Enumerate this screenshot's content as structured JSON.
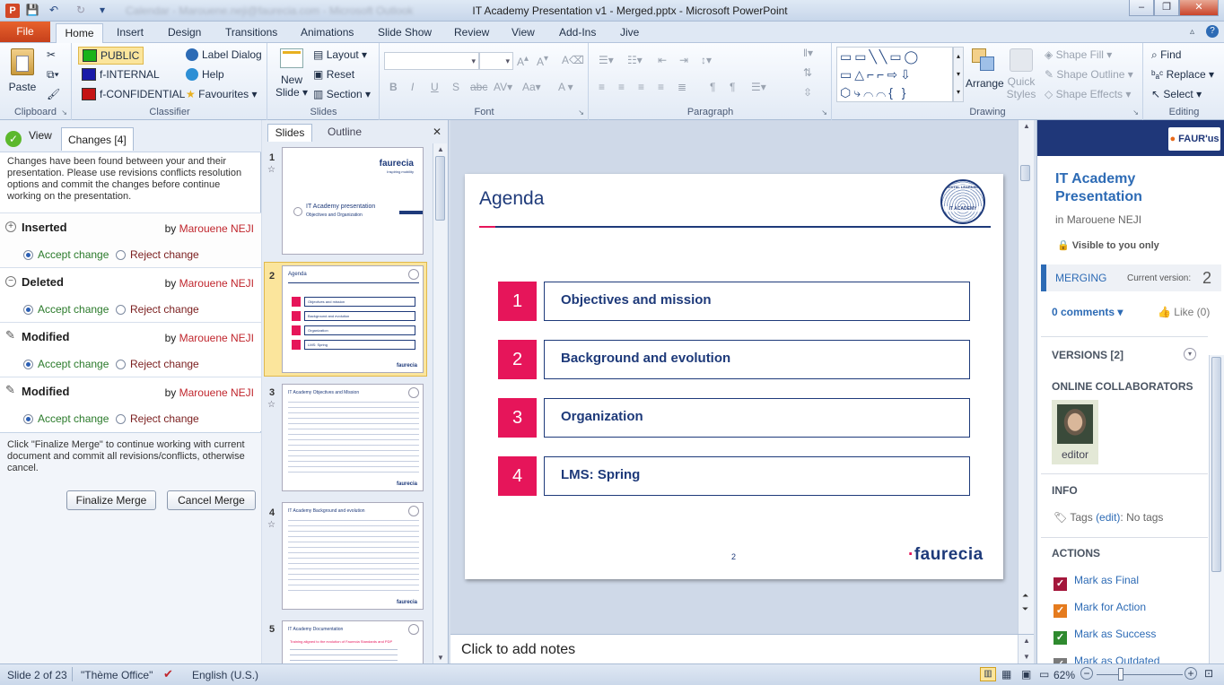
{
  "window": {
    "title": "IT Academy Presentation v1 - Merged.pptx - Microsoft PowerPoint",
    "blurred_title": "Calendar - Marouene.neji@faurecia.com - Microsoft Outlook"
  },
  "tabs": [
    "File",
    "Home",
    "Insert",
    "Design",
    "Transitions",
    "Animations",
    "Slide Show",
    "Review",
    "View",
    "Add-Ins",
    "Jive"
  ],
  "ribbon": {
    "clipboard": {
      "label": "Clipboard",
      "paste": "Paste"
    },
    "classifier": {
      "label": "Classifier",
      "items": [
        {
          "label": "PUBLIC",
          "color": "#19b219"
        },
        {
          "label": "f-INTERNAL",
          "color": "#1a1aa8"
        },
        {
          "label": "f-CONFIDENTIAL",
          "color": "#c41414"
        }
      ],
      "label_dialog": "Label Dialog",
      "help": "Help",
      "favourites": "Favourites"
    },
    "slides": {
      "label": "Slides",
      "new_slide": "New",
      "new_slide2": "Slide",
      "layout": "Layout",
      "reset": "Reset",
      "section": "Section"
    },
    "font": {
      "label": "Font"
    },
    "paragraph": {
      "label": "Paragraph"
    },
    "drawing": {
      "label": "Drawing",
      "arrange": "Arrange",
      "quick": "Quick",
      "styles": "Styles",
      "shape_fill": "Shape Fill",
      "shape_outline": "Shape Outline",
      "shape_effects": "Shape Effects"
    },
    "editing": {
      "label": "Editing",
      "find": "Find",
      "replace": "Replace",
      "select": "Select"
    }
  },
  "review_panel": {
    "view_tab": "View",
    "changes_tab": "Changes [4]",
    "message": "Changes have been found between your and their presentation. Please use revisions conflicts resolution options and commit the changes before continue working on the presentation.",
    "changes": [
      {
        "type": "Inserted",
        "by": "by",
        "author": "Marouene NEJI",
        "accept": "Accept change",
        "reject": "Reject change"
      },
      {
        "type": "Deleted",
        "by": "by",
        "author": "Marouene NEJI",
        "accept": "Accept change",
        "reject": "Reject change"
      },
      {
        "type": "Modified",
        "by": "by",
        "author": "Marouene NEJI",
        "accept": "Accept change",
        "reject": "Reject change"
      },
      {
        "type": "Modified",
        "by": "by",
        "author": "Marouene NEJI",
        "accept": "Accept change",
        "reject": "Reject change"
      }
    ],
    "finalize_msg": "Click \"Finalize Merge\" to continue working with current document and commit all revisions/conflicts, otherwise cancel.",
    "finalize_btn": "Finalize Merge",
    "cancel_btn": "Cancel Merge"
  },
  "slides_panel": {
    "tab_slides": "Slides",
    "tab_outline": "Outline",
    "thumbs": [
      {
        "num": "1",
        "title": "IT Academy presentation",
        "subtitle": "Objectives and Organization",
        "brand": "faurecia",
        "tagline": "Inspiring mobility"
      },
      {
        "num": "2",
        "title": "Agenda",
        "items": [
          "Objectives and mission",
          "Background and evolution",
          "Organization",
          "LMS: Spring"
        ]
      },
      {
        "num": "3",
        "title": "IT Academy Objectives and Mission"
      },
      {
        "num": "4",
        "title": "IT Academy Background and evolution"
      },
      {
        "num": "5",
        "title": "IT Academy Documentation",
        "line": "Training aligned to the evolution of Faurecia Standards and PDP"
      }
    ]
  },
  "slide": {
    "title": "Agenda",
    "items": [
      {
        "num": "1",
        "label": "Objectives and mission"
      },
      {
        "num": "2",
        "label": "Background and evolution"
      },
      {
        "num": "3",
        "label": "Organization"
      },
      {
        "num": "4",
        "label": "LMS: Spring"
      }
    ],
    "page": "2",
    "brand": "faurecia",
    "badge_top": "DIGITAL LEARNING",
    "badge_bottom": "IT ACADEMY"
  },
  "notes_placeholder": "Click to add notes",
  "jive": {
    "brand": "FAUR'us",
    "title": "IT Academy Presentation",
    "in": "in",
    "owner": "Marouene NEJI",
    "visibility": "Visible to you only",
    "merging": "MERGING",
    "current_version_label": "Current version:",
    "current_version": "2",
    "comments": "0 comments",
    "like": "Like (0)",
    "versions": "VERSIONS [2]",
    "collaborators": "ONLINE COLLABORATORS",
    "collaborator_role": "editor",
    "info": "INFO",
    "tags_label": "Tags",
    "tags_edit": "(edit)",
    "tags_value": ": No tags",
    "actions_label": "ACTIONS",
    "actions": [
      {
        "label": "Mark as Final",
        "color": "#a4173b"
      },
      {
        "label": "Mark for Action",
        "color": "#e57b1e"
      },
      {
        "label": "Mark as Success",
        "color": "#2f8a2f"
      },
      {
        "label": "Mark as Outdated",
        "color": "#7a7a7a"
      }
    ]
  },
  "status": {
    "slide": "Slide 2 of 23",
    "theme": "\"Thème Office\"",
    "language": "English (U.S.)",
    "zoom": "62%"
  }
}
